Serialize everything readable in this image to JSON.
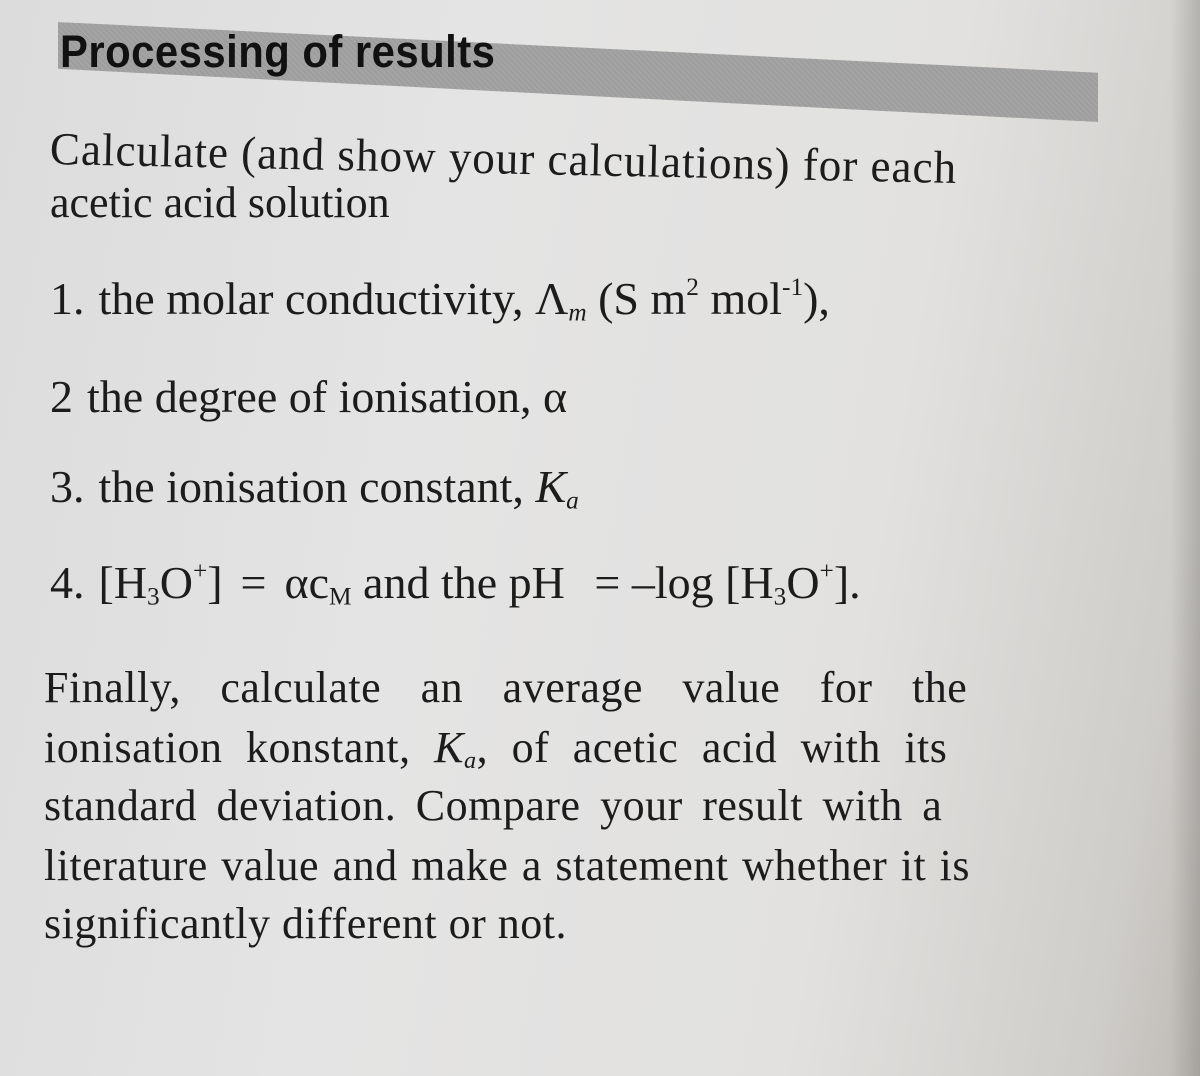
{
  "section": {
    "heading": "Processing of results",
    "intro_line1": "Calculate (and show your calculations) for each",
    "intro_line2": "acetic acid solution"
  },
  "items": [
    {
      "number": "1.",
      "text": "the molar conductivity, ",
      "symbol": "Λ",
      "symbol_sub": "m",
      "unit_open": " (S m",
      "unit_sup1": "2",
      "unit_mid": " mol",
      "unit_sup2": "-1",
      "unit_close": "),"
    },
    {
      "number": "2",
      "text": "the degree of ionisation, ",
      "symbol": "α"
    },
    {
      "number": "3.",
      "text": "the ionisation constant, ",
      "symbol": "K",
      "symbol_sub": "a"
    },
    {
      "number": "4.",
      "bracket_open": "[H",
      "h_sub": "3",
      "o": "O",
      "plus": "+",
      "bracket_close": "]",
      "equals": "=",
      "alpha_c": "αc",
      "c_sub": "M",
      "middle": " and the pH ",
      "equals2": "=",
      "neglog": " –log [H",
      "h_sub2": "3",
      "o2": "O",
      "plus2": "+",
      "end": "]."
    }
  ],
  "conclusion": {
    "line1": "Finally, calculate an average value for the",
    "line2_a": "ionisation konstant, ",
    "line2_k": "K",
    "line2_sub": "a",
    "line2_b": ", of acetic acid with its",
    "line3": "standard deviation. Compare your result with a",
    "line4": "literature value and make a statement whether it is",
    "line5": "significantly different or not."
  }
}
